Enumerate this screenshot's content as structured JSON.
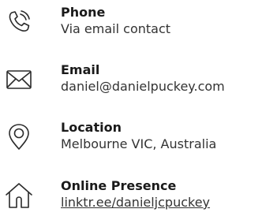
{
  "colors": {
    "title": "#1a1a1a",
    "text": "#333333",
    "icon_stroke": "#2a2a2a"
  },
  "contacts": [
    {
      "icon": "phone-icon",
      "title": "Phone",
      "detail": "Via email contact"
    },
    {
      "icon": "envelope-icon",
      "title": "Email",
      "detail": "daniel@danielpuckey.com"
    },
    {
      "icon": "map-pin-icon",
      "title": "Location",
      "detail": "Melbourne VIC, Australia"
    },
    {
      "icon": "house-icon",
      "title": "Online Presence",
      "detail": "linktr.ee/danieljcpuckey"
    }
  ]
}
